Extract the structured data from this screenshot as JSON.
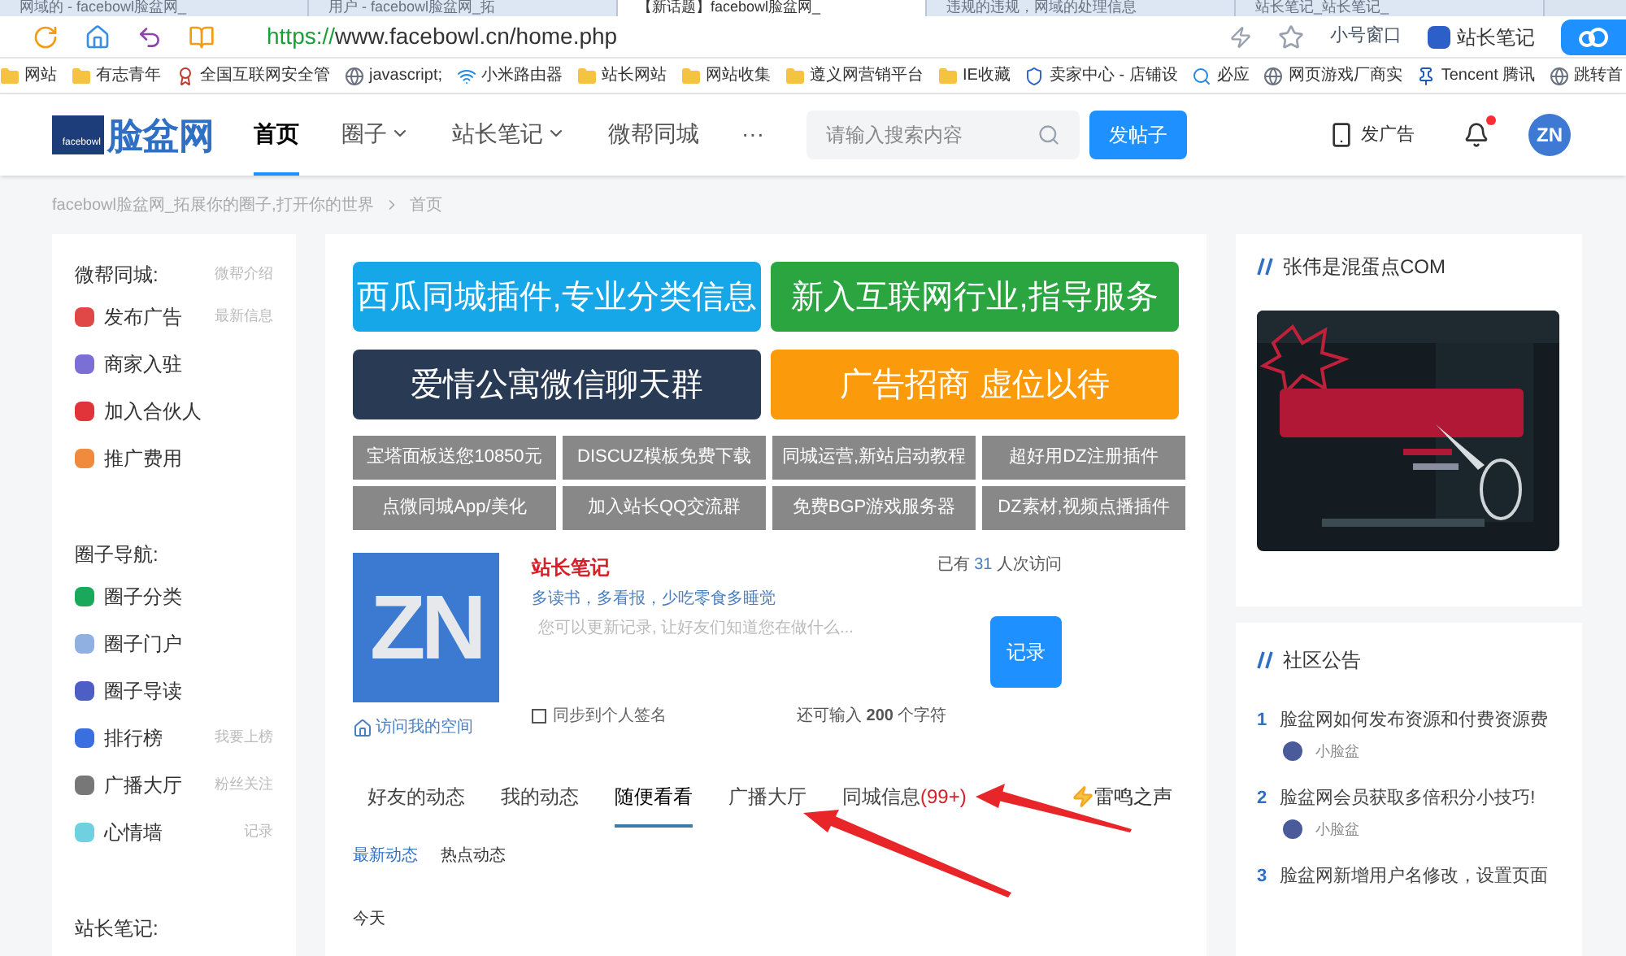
{
  "browser": {
    "tabs": [
      {
        "title": "网域的 - facebowl脸盆网_",
        "selected": false
      },
      {
        "title": "用户 - facebowl脸盆网_拓",
        "selected": false
      },
      {
        "title": "【新话题】facebowl脸盆网_",
        "selected": true
      },
      {
        "title": "违规的违规，网域的处理信息",
        "selected": false
      },
      {
        "title": "站长笔记_站长笔记_",
        "selected": false
      }
    ],
    "url_scheme": "https://",
    "url_rest": "www.facebowl.cn/home.php",
    "small_window": "小号窗口",
    "profile": "站长笔记",
    "bookmarks": [
      {
        "label": "网站",
        "kind": "folder"
      },
      {
        "label": "有志青年",
        "kind": "folder"
      },
      {
        "label": "全国互联网安全管",
        "kind": "badge"
      },
      {
        "label": "javascript;",
        "kind": "globe"
      },
      {
        "label": "小米路由器",
        "kind": "wifi"
      },
      {
        "label": "站长网站",
        "kind": "folder"
      },
      {
        "label": "网站收集",
        "kind": "folder"
      },
      {
        "label": "遵义网营销平台",
        "kind": "folder"
      },
      {
        "label": "IE收藏",
        "kind": "folder"
      },
      {
        "label": "卖家中心 - 店铺设",
        "kind": "shield"
      },
      {
        "label": "必应",
        "kind": "search"
      },
      {
        "label": "网页游戏厂商实",
        "kind": "globe"
      },
      {
        "label": "Tencent 腾讯",
        "kind": "pin"
      },
      {
        "label": "跳转首",
        "kind": "globe"
      }
    ]
  },
  "header": {
    "logo_badge": "facebowl",
    "logo": "脸盆网",
    "nav": [
      {
        "label": "首页",
        "selected": true,
        "dropdown": false
      },
      {
        "label": "圈子",
        "selected": false,
        "dropdown": true
      },
      {
        "label": "站长笔记",
        "selected": false,
        "dropdown": true
      },
      {
        "label": "微帮同城",
        "selected": false,
        "dropdown": false
      },
      {
        "label": "···",
        "selected": false,
        "dropdown": false
      }
    ],
    "search": {
      "placeholder": "请输入搜索内容"
    },
    "post_button": "发帖子",
    "ad_link": "发广告",
    "notification_dot": true,
    "avatar": "ZN"
  },
  "breadcrumb": [
    "facebowl脸盆网_拓展你的圈子,打开你的世界",
    "首页"
  ],
  "sidebar": {
    "sections": [
      {
        "title": "微帮同城:",
        "note": "微帮介绍",
        "items": [
          {
            "label": "发布广告",
            "note": "最新信息",
            "color": "#e04848"
          },
          {
            "label": "商家入驻",
            "color": "#7b6fd6"
          },
          {
            "label": "加入合伙人",
            "color": "#e0333a"
          },
          {
            "label": "推广费用",
            "color": "#f08a3c"
          }
        ]
      },
      {
        "title": "圈子导航:",
        "items": [
          {
            "label": "圈子分类",
            "color": "#1aa85a"
          },
          {
            "label": "圈子门户",
            "color": "#8fb0e0"
          },
          {
            "label": "圈子导读",
            "color": "#4d5fc4"
          },
          {
            "label": "排行榜",
            "note": "我要上榜",
            "color": "#3a6fe0"
          },
          {
            "label": "广播大厅",
            "note": "粉丝关注",
            "color": "#777777"
          },
          {
            "label": "心情墙",
            "note": "记录",
            "color": "#6fd0e0"
          }
        ]
      },
      {
        "title": "站长笔记:"
      }
    ]
  },
  "banners": [
    {
      "text": "西瓜同城插件,专业分类信息",
      "color": "#16a7e9"
    },
    {
      "text": "新入互联网行业,指导服务",
      "color": "#2aa540"
    },
    {
      "text": "爱情公寓微信聊天群",
      "color": "#283a54"
    },
    {
      "text": "广告招商 虚位以待",
      "color": "#fb9a0a"
    }
  ],
  "links": [
    "宝塔面板送您10850元",
    "DISCUZ模板免费下载",
    "同城运营,新站启动教程",
    "超好用DZ注册插件",
    "点微同城App/美化",
    "加入站长QQ交流群",
    "免费BGP游戏服务器",
    "DZ素材,视频点播插件"
  ],
  "profile": {
    "avatar": "ZN",
    "name": "站长笔记",
    "motto": "多读书，多看报，少吃零食多睡觉",
    "visits_before": "已有",
    "visits_count": "31",
    "visits_after": "人次访问",
    "placeholder": "您可以更新记录, 让好友们知道您在做什么...",
    "submit": "记录",
    "sync_label": "同步到个人签名",
    "sync_checked": false,
    "remaining": "还可输入 **200** 个字符",
    "space_link": "访问我的空间"
  },
  "feed_tabs": [
    {
      "label": "好友的动态",
      "selected": false
    },
    {
      "label": "我的动态",
      "selected": false
    },
    {
      "label": "随便看看",
      "selected": true
    },
    {
      "label": "广播大厅",
      "selected": false
    },
    {
      "label": "同城信息",
      "count": "(99+)",
      "selected": false
    }
  ],
  "thunder": "雷鸣之声",
  "sub_tabs": [
    {
      "label": "最新动态",
      "selected": true
    },
    {
      "label": "热点动态",
      "selected": false
    }
  ],
  "day": "今天",
  "right": {
    "ad_title": "张伟是混蛋点COM",
    "notice_title": "社区公告",
    "notices": [
      {
        "num": "1",
        "title": "脸盆网如何发布资源和付费资源费",
        "author": "小脸盆"
      },
      {
        "num": "2",
        "title": "脸盆网会员获取多倍积分小技巧!",
        "author": "小脸盆"
      },
      {
        "num": "3",
        "title": "脸盆网新增用户名修改，设置页面"
      }
    ]
  }
}
